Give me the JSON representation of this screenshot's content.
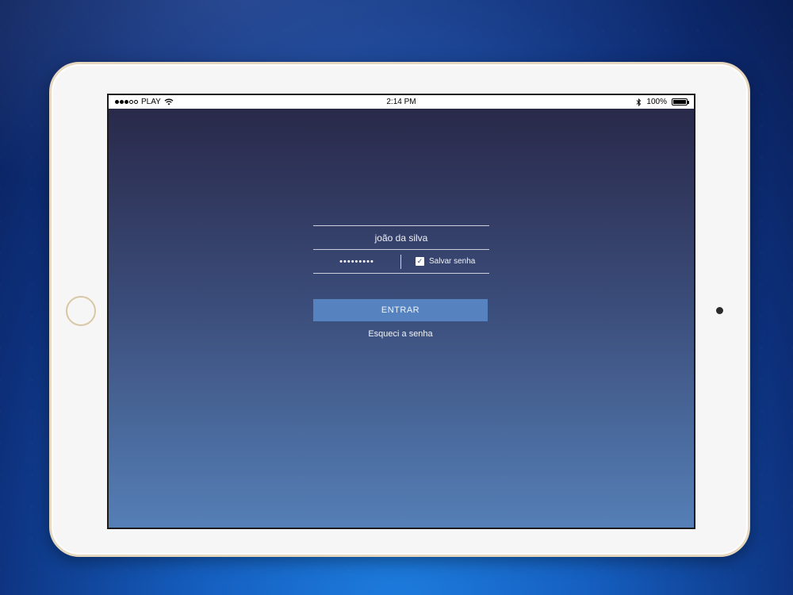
{
  "status_bar": {
    "carrier": "PLAY",
    "time": "2:14 PM",
    "battery": "100%"
  },
  "login": {
    "username_value": "joão da silva",
    "password_mask": "•••••••••",
    "remember_label": "Salvar senha",
    "remember_checked": true,
    "enter_label": "ENTRAR",
    "forgot_label": "Esqueci a senha"
  },
  "colors": {
    "button": "#5683c0",
    "gradient_top": "#29294a",
    "gradient_bottom": "#557fb6"
  },
  "icons": [
    "signal-dots-icon",
    "wifi-icon",
    "bluetooth-icon",
    "battery-icon",
    "check-icon"
  ]
}
